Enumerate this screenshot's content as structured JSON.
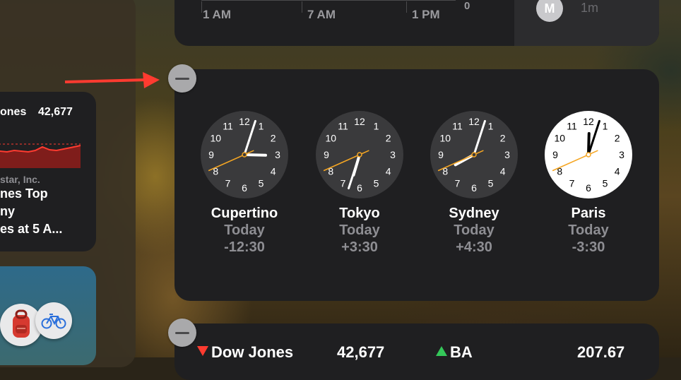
{
  "colors": {
    "accent_arrow": "#ff3b30",
    "second_hand": "#f5a623",
    "card_bg": "#1f1f21",
    "down": "#ff3b30",
    "up": "#34c759"
  },
  "left_stock_card": {
    "name": "ones",
    "value": "42,677",
    "news_source": "star, Inc.",
    "news_lines": [
      "nes Top",
      "ny",
      "es at 5 A..."
    ]
  },
  "top_card": {
    "axis_labels": [
      "1 AM",
      "7 AM",
      "1 PM"
    ],
    "axis_zero": "0",
    "avatar_initial": "M",
    "time_ago": "1m"
  },
  "world_clock": {
    "clocks": [
      {
        "city": "Cupertino",
        "day": "Today",
        "offset": "-12:30",
        "theme": "dark",
        "hour": 3,
        "minute": 3,
        "second": 41
      },
      {
        "city": "Tokyo",
        "day": "Today",
        "offset": "+3:30",
        "theme": "dark",
        "hour": 6,
        "minute": 33,
        "second": 41
      },
      {
        "city": "Sydney",
        "day": "Today",
        "offset": "+4:30",
        "theme": "dark",
        "hour": 8,
        "minute": 3,
        "second": 41
      },
      {
        "city": "Paris",
        "day": "Today",
        "offset": "-3:30",
        "theme": "light",
        "hour": 12,
        "minute": 3,
        "second": 41
      }
    ]
  },
  "stocks_card": {
    "rows": [
      {
        "direction": "down",
        "symbol": "Dow Jones",
        "value": "42,677"
      },
      {
        "direction": "up",
        "symbol": "BA",
        "value": "207.67"
      }
    ]
  },
  "icons": {
    "remove": "minus-circle-icon",
    "arrow": "red-arrow-icon",
    "backpack": "backpack-icon",
    "bicycle": "bicycle-icon"
  }
}
